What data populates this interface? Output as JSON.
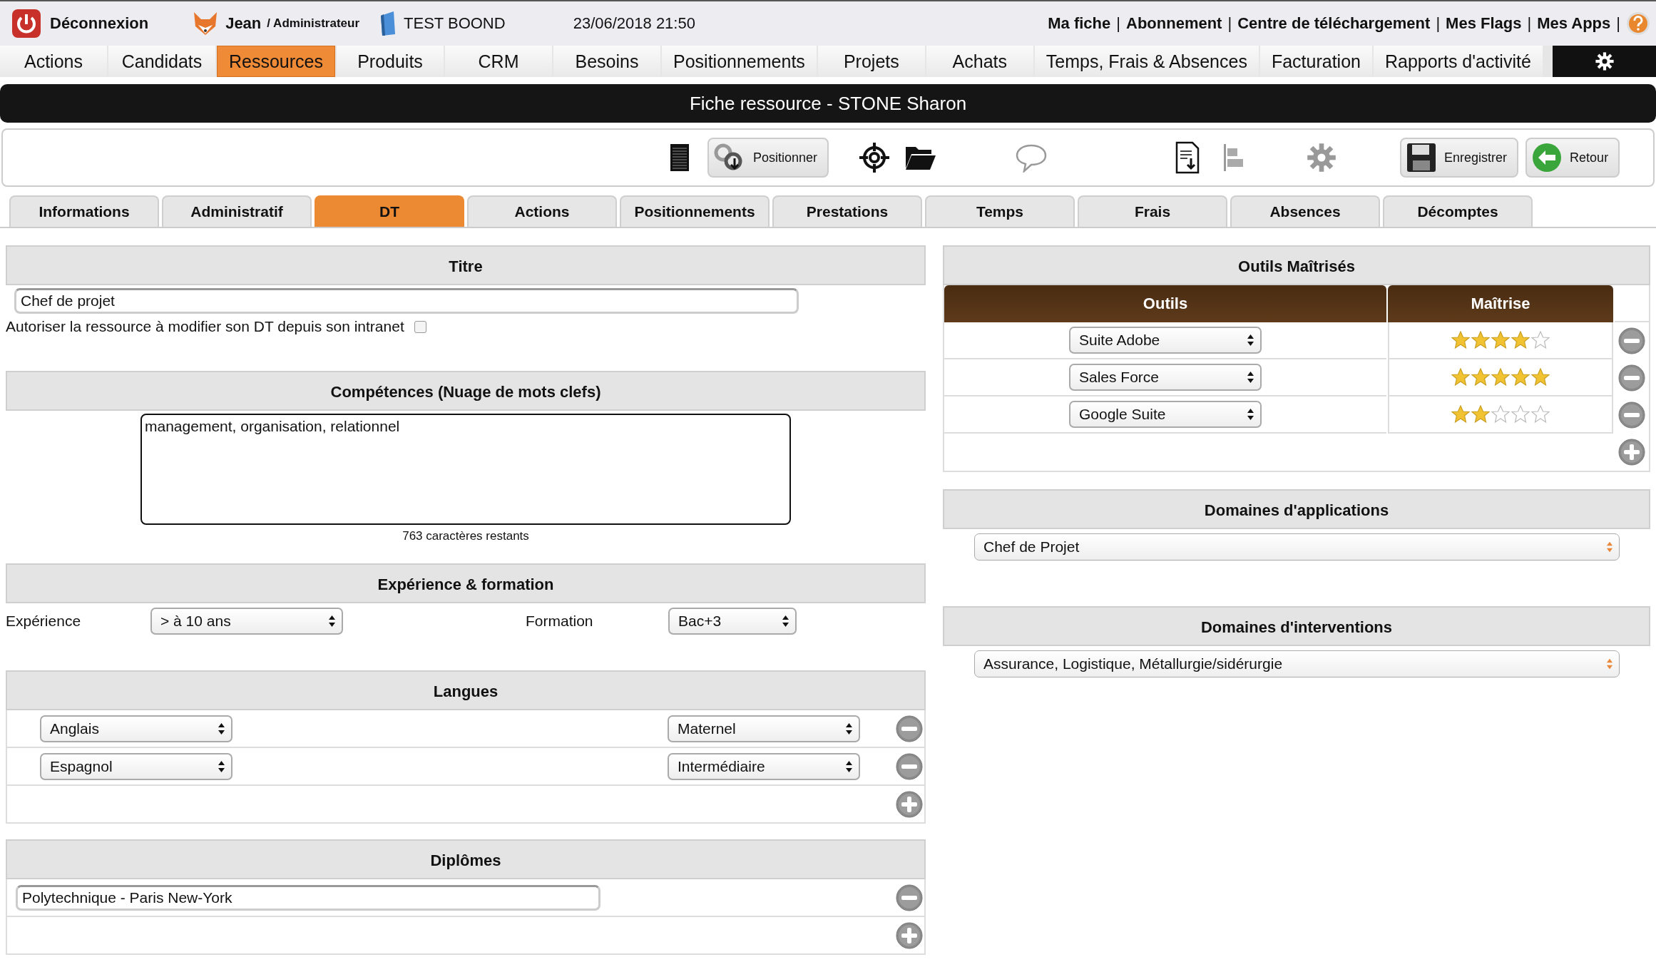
{
  "topbar": {
    "logout": "Déconnexion",
    "user": "Jean",
    "role": "/ Administrateur",
    "company": "TEST BOOND",
    "datetime": "23/06/2018 21:50",
    "separator": "|",
    "links": [
      "Ma fiche",
      "Abonnement",
      "Centre de téléchargement",
      "Mes Flags",
      "Mes Apps"
    ]
  },
  "menu": [
    {
      "label": "Actions",
      "selected": false
    },
    {
      "label": "Candidats",
      "selected": false
    },
    {
      "label": "Ressources",
      "selected": true
    },
    {
      "label": "Produits",
      "selected": false
    },
    {
      "label": "CRM",
      "selected": false
    },
    {
      "label": "Besoins",
      "selected": false
    },
    {
      "label": "Positionnements",
      "selected": false
    },
    {
      "label": "Projets",
      "selected": false
    },
    {
      "label": "Achats",
      "selected": false
    },
    {
      "label": "Temps, Frais & Absences",
      "selected": false
    },
    {
      "label": "Facturation",
      "selected": false
    },
    {
      "label": "Rapports d'activité",
      "selected": false
    }
  ],
  "page_title": "Fiche ressource - STONE Sharon",
  "toolbar": {
    "position_button": "Positionner",
    "save_button": "Enregistrer",
    "back_button": "Retour"
  },
  "tabs": [
    {
      "label": "Informations",
      "selected": false
    },
    {
      "label": "Administratif",
      "selected": false
    },
    {
      "label": "DT",
      "selected": true
    },
    {
      "label": "Actions",
      "selected": false
    },
    {
      "label": "Positionnements",
      "selected": false
    },
    {
      "label": "Prestations",
      "selected": false
    },
    {
      "label": "Temps",
      "selected": false
    },
    {
      "label": "Frais",
      "selected": false
    },
    {
      "label": "Absences",
      "selected": false
    },
    {
      "label": "Décomptes",
      "selected": false
    }
  ],
  "titre": {
    "heading": "Titre",
    "value": "Chef de projet",
    "allow_label": "Autoriser la ressource à modifier son DT depuis son intranet",
    "allow_checked": false
  },
  "competences": {
    "heading": "Compétences (Nuage de mots clefs)",
    "value": "management, organisation, relationnel",
    "remaining": "763 caractères restants"
  },
  "experience": {
    "heading": "Expérience & formation",
    "experience_label": "Expérience",
    "experience_value": "> à 10 ans",
    "formation_label": "Formation",
    "formation_value": "Bac+3"
  },
  "langues": {
    "heading": "Langues",
    "rows": [
      {
        "language": "Anglais",
        "level_value": "Maternel"
      },
      {
        "language": "Espagnol",
        "level_value": "Intermédiaire"
      }
    ]
  },
  "diplomes": {
    "heading": "Diplômes",
    "rows": [
      "Polytechnique - Paris New-York"
    ]
  },
  "outils": {
    "heading": "Outils Maîtrisés",
    "columns": [
      "Outils",
      "Maîtrise"
    ],
    "rows": [
      {
        "tool": "Suite Adobe",
        "stars": 4
      },
      {
        "tool": "Sales Force",
        "stars": 5
      },
      {
        "tool": "Google Suite",
        "stars": 2
      }
    ]
  },
  "domaines_applications": {
    "heading": "Domaines d'applications",
    "value": "Chef de Projet"
  },
  "domaines_interventions": {
    "heading": "Domaines d'interventions",
    "value": "Assurance, Logistique, Métallurgie/sidérurgie"
  }
}
